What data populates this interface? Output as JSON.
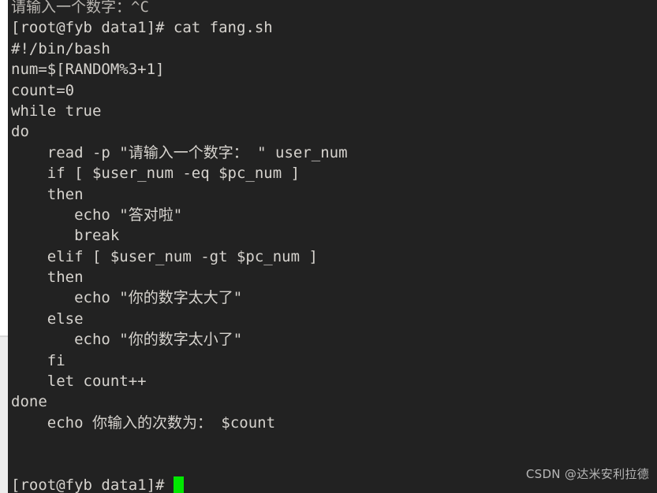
{
  "terminal": {
    "background_color": "#222222",
    "foreground_color": "#d6d3ce",
    "cursor_color": "#00e800",
    "lines": [
      {
        "text": "请输入一个数字：^C",
        "style": "clipped"
      },
      {
        "text": "[root@fyb data1]# cat fang.sh",
        "style": "normal"
      },
      {
        "text": "#!/bin/bash",
        "style": "normal"
      },
      {
        "text": "num=$[RANDOM%3+1]",
        "style": "normal"
      },
      {
        "text": "count=0",
        "style": "normal"
      },
      {
        "text": "while true",
        "style": "normal"
      },
      {
        "text": "do",
        "style": "normal"
      },
      {
        "text": "    read -p \"请输入一个数字： \" user_num",
        "style": "normal"
      },
      {
        "text": "    if [ $user_num -eq $pc_num ]",
        "style": "normal"
      },
      {
        "text": "    then",
        "style": "normal"
      },
      {
        "text": "       echo \"答对啦\"",
        "style": "normal"
      },
      {
        "text": "       break",
        "style": "normal"
      },
      {
        "text": "    elif [ $user_num -gt $pc_num ]",
        "style": "normal"
      },
      {
        "text": "    then",
        "style": "normal"
      },
      {
        "text": "       echo \"你的数字太大了\"",
        "style": "normal"
      },
      {
        "text": "    else",
        "style": "normal"
      },
      {
        "text": "       echo \"你的数字太小了\"",
        "style": "normal"
      },
      {
        "text": "    fi",
        "style": "normal"
      },
      {
        "text": "    let count++",
        "style": "normal"
      },
      {
        "text": "done",
        "style": "normal"
      },
      {
        "text": "    echo 你输入的次数为： $count",
        "style": "normal"
      },
      {
        "text": "",
        "style": "blank"
      },
      {
        "text": "",
        "style": "blank"
      }
    ],
    "prompt": {
      "text": "[root@fyb data1]# ",
      "cursor": "block-cursor"
    }
  },
  "watermark": {
    "text": "CSDN @达米安利拉德"
  }
}
